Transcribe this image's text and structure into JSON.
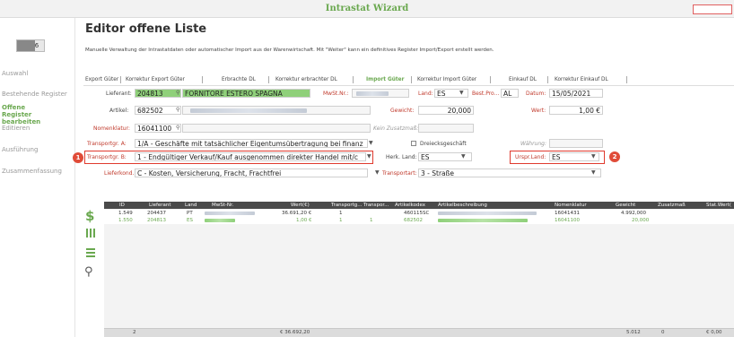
{
  "window": {
    "title": "Intrastat Wizard"
  },
  "sidebar": {
    "step_text": "6",
    "items": [
      {
        "label": "Auswahl",
        "active": false
      },
      {
        "label": "Bestehende Register",
        "active": false
      },
      {
        "label": "Offene Register bearbeiten",
        "active": true
      },
      {
        "label": "Editieren",
        "active": false
      },
      {
        "label": "Ausführung",
        "active": false
      },
      {
        "label": "Zusammenfassung",
        "active": false
      }
    ]
  },
  "header": {
    "title": "Editor offene Liste",
    "description": "Manuelle Verwaltung der Intrastatdaten oder automatischer Import aus der Warenwirtschaft. Mit \"Weiter\" kann ein definitives Register Import/Export erstellt werden."
  },
  "tabs": [
    {
      "label": "Export Güter"
    },
    {
      "label": "Korrektur Export Güter"
    },
    {
      "label": "Erbrachte DL"
    },
    {
      "label": "Korrektur erbrachter DL"
    },
    {
      "label": "Import Güter",
      "selected": true
    },
    {
      "label": "Korrektur Import Güter"
    },
    {
      "label": "Einkauf DL"
    },
    {
      "label": "Korrektur Einkauf DL"
    }
  ],
  "form": {
    "lieferant_label": "Lieferant:",
    "lieferant_value": "204813",
    "lieferant_name": "FORNITORE ESTERO SPAGNA",
    "mwst_label": "MwSt.Nr.:",
    "land_label": "Land:",
    "land_value": "ES",
    "bestpro_label": "Best.Pro...",
    "bestpro_value": "AL",
    "datum_label": "Datum:",
    "datum_value": "15/05/2021",
    "artikel_label": "Artikel:",
    "artikel_value": "682502",
    "gewicht_label": "Gewicht:",
    "gewicht_value": "20,000",
    "wert_label": "Wert:",
    "wert_value": "1,00 €",
    "nomenklatur_label": "Nomenklatur:",
    "nomenklatur_value": "16041100",
    "kein_zusatzmass_label": "Kein Zusatzmaß:",
    "transportgr_a_label": "Transportgr. A:",
    "transportgr_a_value": "1/A - Geschäfte mit tatsächlicher Eigentumsübertragung bei finanz",
    "dreiecks_label": "Dreiecksgeschäft",
    "waehrung_label": "Währung:",
    "transportgr_b_label": "Transportgr. B:",
    "transportgr_b_value": "1 - Endgültiger Verkauf/Kauf ausgenommen direkter Handel mit/c",
    "herk_land_label": "Herk. Land:",
    "herk_land_value": "ES",
    "urspr_land_label": "Urspr.Land:",
    "urspr_land_value": "ES",
    "lieferkond_label": "Lieferkond.:",
    "lieferkond_value": "C - Kosten, Versicherung, Fracht, Frachtfrei",
    "transportart_label": "Transportart:",
    "transportart_value": "3 - Straße"
  },
  "badges": [
    "1",
    "2"
  ],
  "grid": {
    "columns": [
      "ID",
      "Lieferant",
      "Land",
      "MwSt-Nr.",
      "Wert(€)",
      "Transportg...",
      "Transpor...",
      "Artikelkodex",
      "Artikelbeschreibung",
      "Nomenklatur",
      "Gewicht",
      "Zusatzmaß",
      "Stat.Wert("
    ],
    "rows": [
      {
        "id": "1.549",
        "lieferant": "204437",
        "land": "PT",
        "wert": "36.691,20 €",
        "tg": "1",
        "tp": "",
        "artikel": "460115SC",
        "nomenklatur": "16041431",
        "gewicht": "4.992,000",
        "selected": false
      },
      {
        "id": "1.550",
        "lieferant": "204813",
        "land": "ES",
        "wert": "1,00 €",
        "tg": "1",
        "tp": "1",
        "artikel": "682502",
        "nomenklatur": "16041100",
        "gewicht": "20,000",
        "selected": true
      }
    ],
    "footer": {
      "count": "2",
      "wert_total": "€ 36.692,20",
      "gewicht_total": "5.012",
      "zusatz_total": "0",
      "stat_total": "€ 0,00"
    }
  },
  "colors": {
    "accent": "#6aa84f",
    "highlight": "#e03a2e",
    "grid_header": "#4a4a4a"
  },
  "icons": [
    "dollar-icon",
    "grid-icon",
    "list-icon",
    "search-icon",
    "dropdown-arrow-icon",
    "search-lookup-icon"
  ]
}
